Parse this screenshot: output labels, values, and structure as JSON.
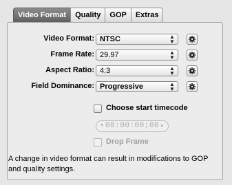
{
  "tabs": [
    {
      "label": "Video Format",
      "active": true
    },
    {
      "label": "Quality",
      "active": false
    },
    {
      "label": "GOP",
      "active": false
    },
    {
      "label": "Extras",
      "active": false
    }
  ],
  "fields": {
    "video_format": {
      "label": "Video Format:",
      "value": "NTSC"
    },
    "frame_rate": {
      "label": "Frame Rate:",
      "value": "29.97"
    },
    "aspect_ratio": {
      "label": "Aspect Ratio:",
      "value": "4:3"
    },
    "field_dominance": {
      "label": "Field Dominance:",
      "value": "Progressive"
    }
  },
  "start_timecode": {
    "label": "Choose start timecode",
    "checked": false
  },
  "timecode": {
    "value": "00:00:00;00",
    "enabled": false
  },
  "drop_frame": {
    "label": "Drop Frame",
    "checked": false,
    "enabled": false
  },
  "note": "A change in video format can result in modifications to GOP and quality settings.",
  "icons": {
    "popup_arrows": "updown-arrows-icon",
    "action": "gear-icon"
  }
}
